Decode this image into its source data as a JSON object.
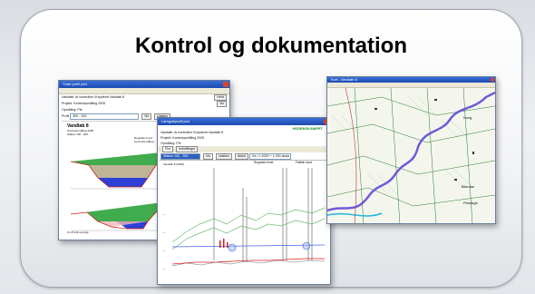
{
  "card": {
    "title": "Kontrol og dokumentation"
  },
  "win1": {
    "title": "Tvær profil plot",
    "label_vandloeb": "Vandløb:",
    "value_vandloeb": "Ar kontrollen lil systemt Vandløb 8",
    "label_projekt": "Projekt:",
    "value_projekt": "Kontrolopmåling 2005",
    "label_opmaaling": "Opmåling:",
    "value_opmaaling": "Ple",
    "label_profil": "Profil",
    "value_profil": "300 - 100",
    "btn_hent": "Hent",
    "btn_vis": "Vis",
    "btn_udskriv": "Udskriv",
    "btn_vis2": "Vis",
    "plot_header": "Vandløb 8",
    "plot_sub1": "Kontrolopmåling 2005",
    "plot_sub2": "Station 100 - 300",
    "legend1": "Regulativ bund",
    "legend2": "Kontrolopmåling",
    "footer": "Km Profil oversigt"
  },
  "win2": {
    "title": "Længdeprofil plot",
    "brand": "HEDENSKAMPET",
    "label_vandloeb": "Vandløb:",
    "value_vandloeb": "Ar kontrollen lil systemt Vandløb 8",
    "label_projekt": "Projekt:",
    "value_projekt": "Kontrolopmåling 2005",
    "label_opmaaling": "Opmåling:",
    "value_opmaaling": "Ple",
    "tab1": "Plot",
    "tab2": "Indstillinger",
    "value_range": "Station 100 - 300",
    "btn_vis": "Vis",
    "btn_udskriv": "Udskriv",
    "btn_afslut": "Afslut",
    "field_info": "Vis i 1:2000 + 1:250 skala",
    "chart_header": "Vandløb 8 (2005)",
    "chart_legend1": "Regulativ bund",
    "chart_legend2": "Faktisk bund",
    "chart_legend3": "Venstre kant / højre kant"
  },
  "win3": {
    "title": "Kort - Vandløb 8",
    "place1": "Bilsrose",
    "place2": "Plantage",
    "place3": "Kong"
  }
}
